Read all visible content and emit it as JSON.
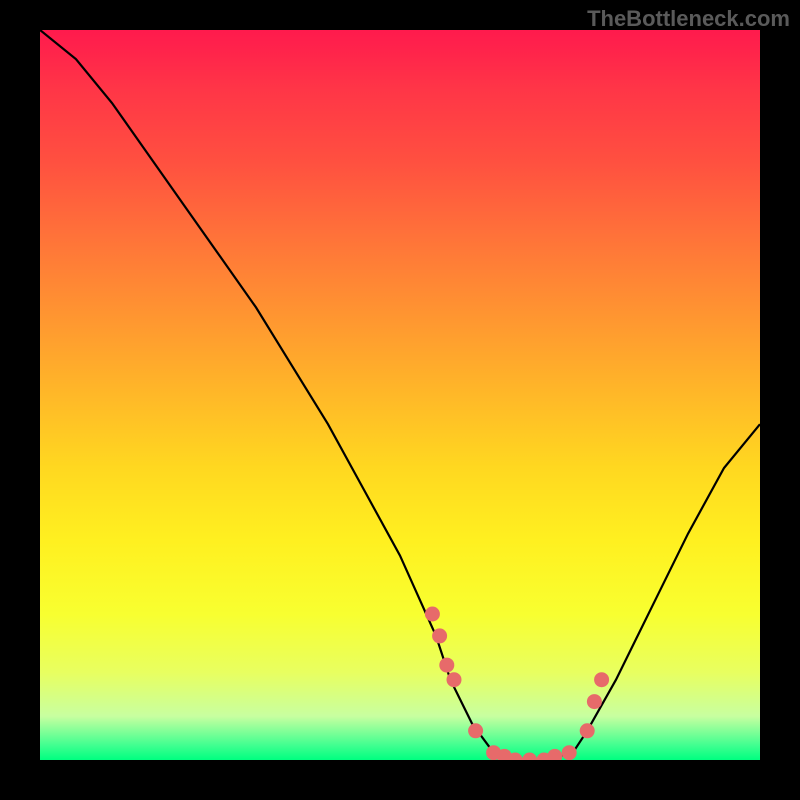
{
  "watermark": "TheBottleneck.com",
  "chart_data": {
    "type": "line",
    "title": "",
    "xlabel": "",
    "ylabel": "",
    "xlim": [
      0,
      100
    ],
    "ylim": [
      0,
      100
    ],
    "curve": {
      "x": [
        0,
        5,
        10,
        15,
        20,
        25,
        30,
        35,
        40,
        45,
        50,
        55,
        57,
        60,
        63,
        66,
        70,
        74,
        76,
        80,
        85,
        90,
        95,
        100
      ],
      "y": [
        100,
        96,
        90,
        83,
        76,
        69,
        62,
        54,
        46,
        37,
        28,
        17,
        11,
        5,
        1,
        0,
        0,
        1,
        4,
        11,
        21,
        31,
        40,
        46
      ]
    },
    "points": {
      "x": [
        54.5,
        55.5,
        56.5,
        57.5,
        60.5,
        63,
        64.5,
        66,
        68,
        70,
        71.5,
        73.5,
        76,
        77,
        78
      ],
      "y": [
        20,
        17,
        13,
        11,
        4,
        1,
        0.5,
        0,
        0,
        0,
        0.5,
        1,
        4,
        8,
        11
      ]
    },
    "gradient_stops": [
      {
        "pos": 0,
        "color": "#ff1a4d"
      },
      {
        "pos": 50,
        "color": "#ffd820"
      },
      {
        "pos": 100,
        "color": "#00ff80"
      }
    ]
  }
}
